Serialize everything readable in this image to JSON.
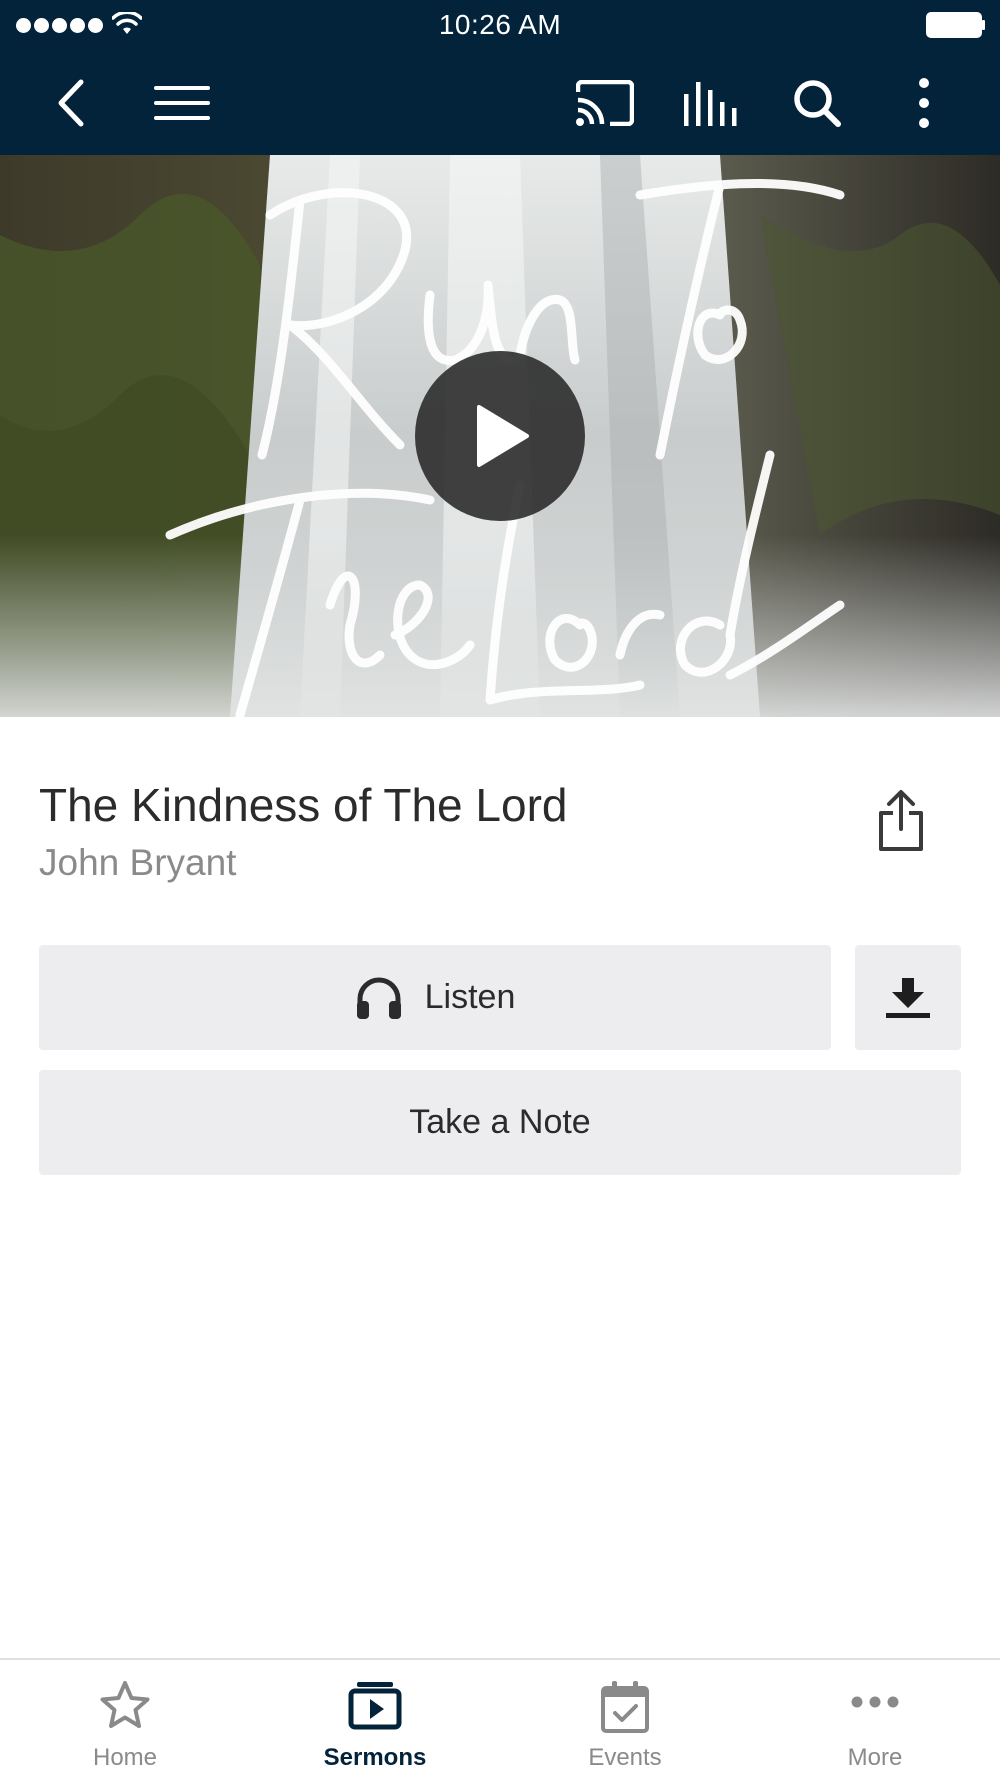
{
  "status_bar": {
    "time": "10:26 AM"
  },
  "nav": {
    "icons": [
      "back-icon",
      "menu-icon",
      "cast-icon",
      "audio-bars-icon",
      "search-icon",
      "more-vertical-icon"
    ]
  },
  "hero": {
    "artwork_text": "Run To The Lord"
  },
  "sermon": {
    "title": "The Kindness of The Lord",
    "speaker": "John Bryant"
  },
  "actions": {
    "listen_label": "Listen",
    "take_note_label": "Take a Note"
  },
  "tabs": [
    {
      "label": "Home",
      "icon": "star-icon",
      "active": false
    },
    {
      "label": "Sermons",
      "icon": "play-folder-icon",
      "active": true
    },
    {
      "label": "Events",
      "icon": "calendar-check-icon",
      "active": false
    },
    {
      "label": "More",
      "icon": "ellipsis-icon",
      "active": false
    }
  ],
  "colors": {
    "header_bg": "#03233a",
    "button_bg": "#ededef",
    "active_tab": "#03233a",
    "inactive_tab": "#8a8a8a"
  }
}
